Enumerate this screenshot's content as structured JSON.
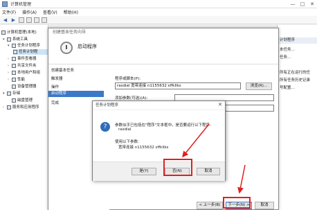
{
  "window": {
    "title": "计算机管理",
    "controls": [
      "—",
      "□",
      "✕"
    ]
  },
  "menu": [
    "文件(F)",
    "操作(A)",
    "查看(V)",
    "帮助(H)"
  ],
  "tree": {
    "root": "计算机管理(本地)",
    "items": [
      "系统工具",
      "任务计划程序",
      "任务计划程",
      "事件查看器",
      "共享文件夹",
      "本地用户和组",
      "性能",
      "设备管理器",
      "存储",
      "磁盘管理",
      "服务和应用程序"
    ]
  },
  "actions": {
    "header": "计划程序",
    "items": [
      "本任务...",
      "任务...",
      "",
      "所有正在运行的任",
      "所有任务历史记录",
      "号配置..."
    ]
  },
  "wizard": {
    "title": "创建基本任务向导",
    "heading": "启动程序",
    "steps": [
      "创建基本任务",
      "触发器",
      "操作",
      "启动程序",
      "完成"
    ],
    "program_label": "程序或脚本(P):",
    "program_value": "rasdial 宽带连接 n1155632 sffkllks",
    "browse": "浏览(R)...",
    "args_label": "添加参数(可选)(A):",
    "start_label": "",
    "back": "< 上一步(B)",
    "next": "下一步(N) >",
    "cancel": "取消"
  },
  "dialog": {
    "title": "任务计划程序",
    "close": "✕",
    "icon": "?",
    "line1": "参数似乎已包括在\"程序\"文本框中。是否要运行以下程序:",
    "line2": "rasdial",
    "line3": "使用以下参数:",
    "line4": "宽带连接 n1155632 sffkllks",
    "yes": "是(Y)",
    "no": "否(N)",
    "cancel": "取消"
  },
  "colors": {
    "annotation": "#e02020",
    "selection": "#3c78c8",
    "question_icon": "#2f6db8"
  }
}
